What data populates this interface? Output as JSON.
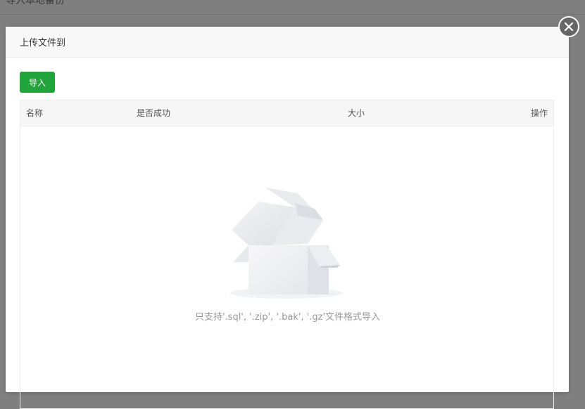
{
  "background": {
    "title": "导入本地备份"
  },
  "modal": {
    "title": "上传文件到",
    "import_button": "导入",
    "columns": {
      "name": "名称",
      "success": "是否成功",
      "size": "大小",
      "ops": "操作"
    },
    "empty_text": "只支持'.sql', '.zip', '.bak', '.gz'文件格式导入"
  },
  "colors": {
    "accent": "#20a53a",
    "close": "#666666"
  },
  "icons": {
    "close": "close-circle-icon",
    "empty": "empty-box-icon"
  }
}
